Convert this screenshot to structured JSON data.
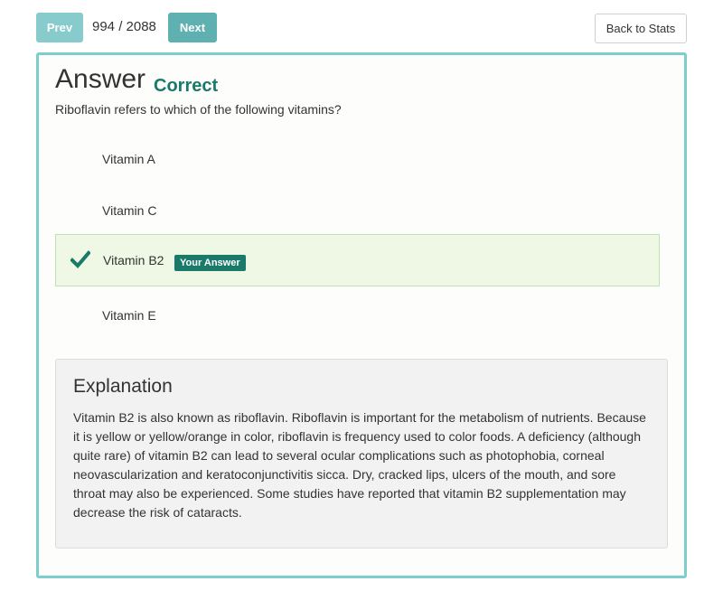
{
  "nav": {
    "prev_label": "Prev",
    "next_label": "Next",
    "counter": "994 / 2088",
    "back_label": "Back to Stats"
  },
  "answer": {
    "title": "Answer",
    "result": "Correct",
    "question": "Riboflavin refers to which of the following vitamins?"
  },
  "options": [
    {
      "label": "Vitamin A"
    },
    {
      "label": "Vitamin C"
    },
    {
      "label": "Vitamin B2",
      "selected": true,
      "badge": "Your Answer",
      "icon": "checkmark-icon"
    },
    {
      "label": "Vitamin E"
    }
  ],
  "explanation": {
    "title": "Explanation",
    "text": "Vitamin B2 is also known as riboflavin. Riboflavin is important for the metabolism of nutrients. Because it is yellow or yellow/orange in color, riboflavin is frequency used to color foods. A deficiency (although quite rare) of vitamin B2 can lead to several ocular complications such as photophobia, corneal neovascularization and keratoconjunctivitis sicca. Dry, cracked lips, ulcers of the mouth, and sore throat may also be experienced. Some studies have reported that vitamin B2 supplementation may decrease the risk of cataracts."
  },
  "colors": {
    "accent": "#5fb0b0",
    "prev_button": "#87cbcd",
    "panel_border": "#7ecdcd",
    "correct_text": "#1a7a6a",
    "selected_bg": "#eef8e4"
  }
}
